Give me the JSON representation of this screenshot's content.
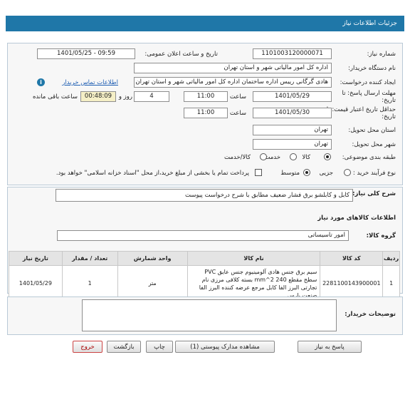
{
  "header": {
    "title": "جزئیات اطلاعات نیاز"
  },
  "form": {
    "need_number_label": "شماره نیاز:",
    "need_number": "1101003120000071",
    "announce_label": "تاریخ و ساعت اعلان عمومی:",
    "announce_value": "1401/05/25 - 09:59",
    "buyer_org_label": "نام دستگاه خریدار:",
    "buyer_org": "اداره کل امور مالیاتی شهر و استان تهران",
    "creator_label": "ایجاد کننده درخواست:",
    "creator": "هادی گرگانی رییس اداره ساختمان اداره کل امور مالیاتی شهر و استان تهران",
    "contact_link": "اطلاعات تماس خریدار",
    "deadline_label": "مهلت ارسال پاسخ: تا تاریخ:",
    "deadline_date": "1401/05/29",
    "time_label": "ساعت",
    "deadline_time": "11:00",
    "days_value": "4",
    "days_label": "روز و",
    "remaining_time": "00:48:09",
    "remaining_label": "ساعت باقی مانده",
    "validity_label": "حداقل تاریخ اعتبار قیمت: تا تاریخ:",
    "validity_date": "1401/05/30",
    "validity_time": "11:00",
    "province_label": "استان محل تحویل:",
    "province": "تهران",
    "city_label": "شهر محل تحویل:",
    "city": "تهران",
    "category_label": "طبقه بندی موضوعی:",
    "category_options": [
      "کالا",
      "خدمت",
      "کالا/خدمت"
    ],
    "process_label": "نوع فرآیند خرید :",
    "process_options": [
      "جزیی",
      "متوسط"
    ],
    "payment_text": "پرداخت تمام یا بخشی از مبلغ خرید،از محل \"اسناد خزانه اسلامی\" خواهد بود."
  },
  "summary": {
    "label": "شرح کلی نیاز:",
    "value": "کابل و کابلشو برق فشار ضعیف مطابق با شرح درخواست پیوست"
  },
  "goods_section": {
    "title": "اطلاعات کالاهای مورد نیاز",
    "group_label": "گروه کالا:",
    "group_value": "امور تاسیساتی"
  },
  "table": {
    "headers": [
      "ردیف",
      "کد کالا",
      "نام کالا",
      "واحد شمارش",
      "تعداد / مقدار",
      "تاریخ نیاز"
    ],
    "rows": [
      {
        "row": "1",
        "code": "2281100143900001",
        "name": "سیم برق جنس هادی آلومینیوم جنس عایق PVC سطح مقطع 240 mm^2 بسته کلافی مرزی نام تجارتی البرز الفا کابل مرجع عرضه کننده البرز الفا صنعت پارس",
        "unit": "متر",
        "qty": "1",
        "date": "1401/05/29"
      }
    ]
  },
  "buyer_notes": {
    "label": "توضیحات خریدار:"
  },
  "buttons": {
    "reply": "پاسخ به نیاز",
    "view_docs": "مشاهده مدارک پیوستی (1)",
    "print": "چاپ",
    "back": "بازگشت",
    "exit": "خروج"
  }
}
